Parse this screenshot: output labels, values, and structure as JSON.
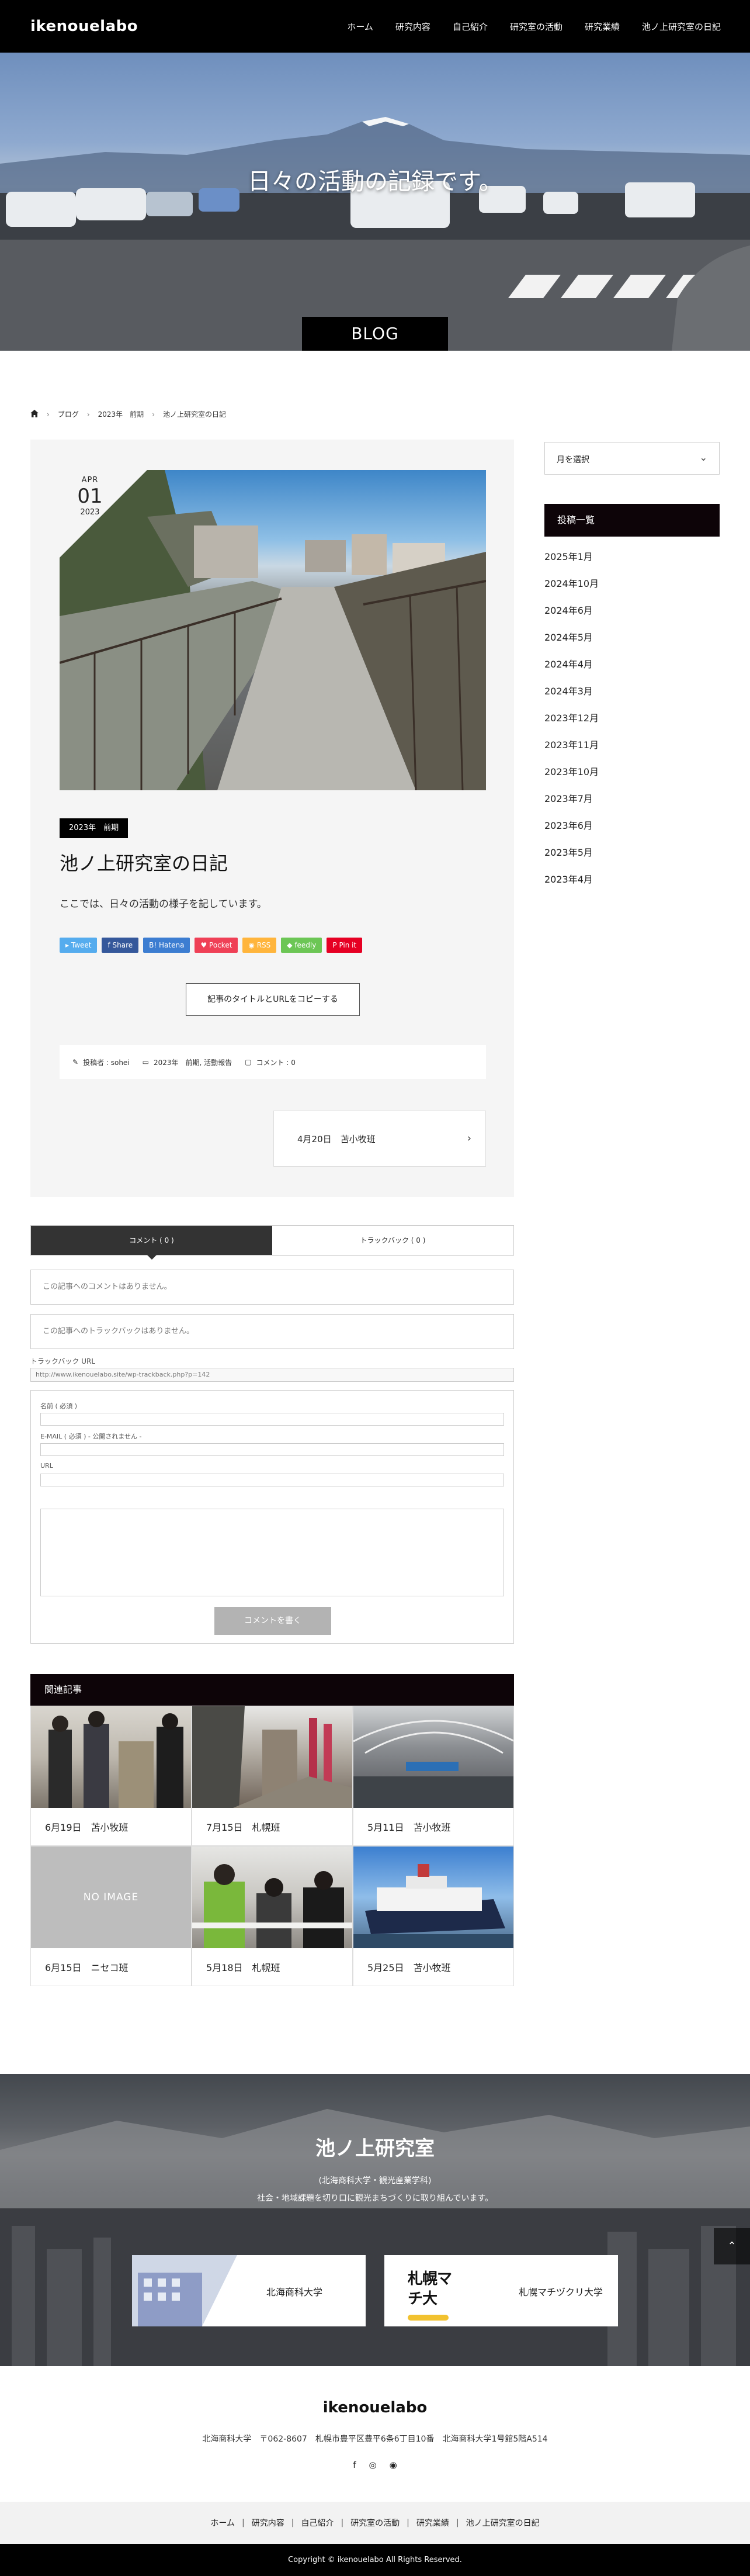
{
  "header": {
    "logo": "ikenouelabo",
    "nav": [
      "ホーム",
      "研究内容",
      "自己紹介",
      "研究室の活動",
      "研究業績",
      "池ノ上研究室の日記"
    ]
  },
  "hero": {
    "caption": "日々の活動の記録です。",
    "badge": "BLOG"
  },
  "breadcrumb": {
    "home_icon": "home-icon",
    "items": [
      "ブログ",
      "2023年　前期",
      "池ノ上研究室の日記"
    ]
  },
  "post": {
    "date": {
      "month": "APR",
      "day": "01",
      "year": "2023"
    },
    "category": "2023年　前期",
    "title": "池ノ上研究室の日記",
    "body": "ここでは、日々の活動の様子を記しています。",
    "share": [
      {
        "label": "Tweet",
        "color": "#55acee"
      },
      {
        "label": "Share",
        "color": "#35589b"
      },
      {
        "label": "Hatena",
        "color": "#3c7dd1"
      },
      {
        "label": "Pocket",
        "color": "#ef4056"
      },
      {
        "label": "RSS",
        "color": "#ffb53c"
      },
      {
        "label": "feedly",
        "color": "#6cc655"
      },
      {
        "label": "Pin it",
        "color": "#e60023"
      }
    ],
    "copy_button": "記事のタイトルとURLをコピーする",
    "meta": {
      "author": "投稿者 : sohei",
      "category": "2023年　前期, 活動報告",
      "comments": "コメント : 0"
    },
    "next_post": "4月20日　苫小牧班"
  },
  "sidebar": {
    "archive_select": "月を選択",
    "widget_title": "投稿一覧",
    "archives": [
      "2025年1月",
      "2024年10月",
      "2024年6月",
      "2024年5月",
      "2024年4月",
      "2024年3月",
      "2023年12月",
      "2023年11月",
      "2023年10月",
      "2023年7月",
      "2023年6月",
      "2023年5月",
      "2023年4月"
    ]
  },
  "comments": {
    "tab_comment": "コメント ( 0 )",
    "tab_trackback": "トラックバック ( 0 )",
    "no_comments": "この記事へのコメントはありません。",
    "no_trackbacks": "この記事へのトラックバックはありません。",
    "trackback_label": "トラックバック URL",
    "trackback_url": "http://www.ikenouelabo.site/wp-trackback.php?p=142",
    "form": {
      "name_label": "名前 ( 必須 )",
      "email_label": "E-MAIL ( 必須 ) - 公開されません -",
      "url_label": "URL",
      "submit": "コメントを書く"
    }
  },
  "related": {
    "title": "関連記事",
    "items": [
      {
        "title": "6月19日　苫小牧班"
      },
      {
        "title": "7月15日　札幌班"
      },
      {
        "title": "5月11日　苫小牧班"
      },
      {
        "title": "6月15日　ニセコ班",
        "placeholder": "NO IMAGE"
      },
      {
        "title": "5月18日　札幌班"
      },
      {
        "title": "5月25日　苫小牧班"
      }
    ]
  },
  "lab": {
    "title": "池ノ上研究室",
    "subtitle": "(北海商科大学・観光産業学科)",
    "description": "社会・地域課題を切り口に観光まちづくりに取り組んでいます。",
    "cards": [
      {
        "label": "北海商科大学"
      },
      {
        "label": "札幌マチヅクリ大学",
        "logo_text": "札幌マチ大"
      }
    ]
  },
  "footer": {
    "name": "ikenouelabo",
    "address": "北海商科大学　〒062-8607　札幌市豊平区豊平6条6丁目10番　北海商科大学1号館5階A514",
    "social": [
      "facebook-icon",
      "instagram-icon",
      "rss-icon"
    ],
    "nav": [
      "ホーム",
      "研究内容",
      "自己紹介",
      "研究室の活動",
      "研究業績",
      "池ノ上研究室の日記"
    ],
    "copyright": "Copyright © ikenouelabo All Rights Reserved."
  }
}
